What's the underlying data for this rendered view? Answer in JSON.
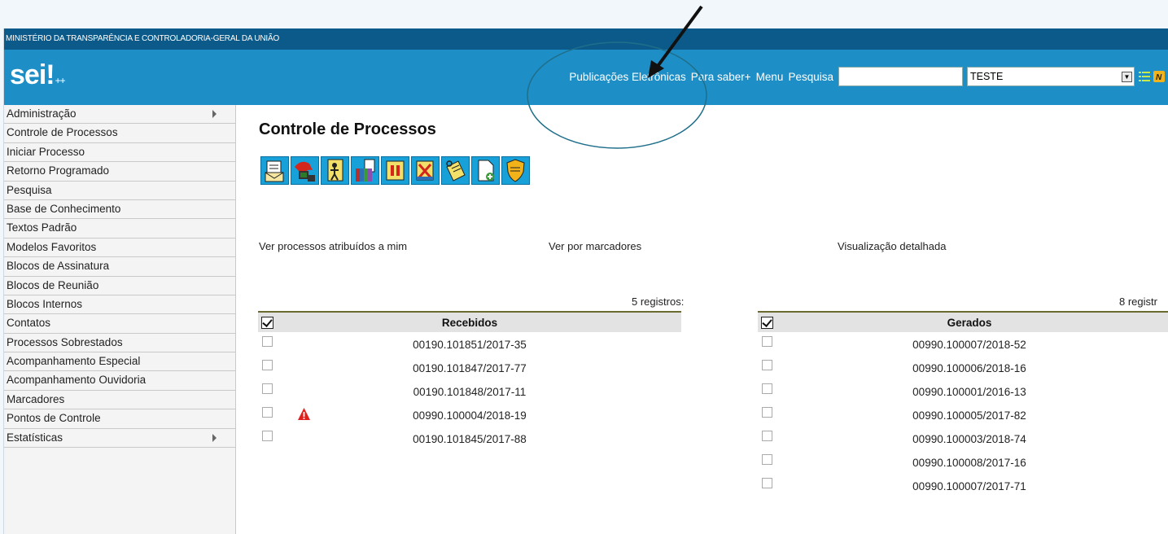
{
  "org_name": "MINISTÉRIO DA TRANSPARÊNCIA E CONTROLADORIA-GERAL DA UNIÃO",
  "logo": {
    "text": "sei!",
    "suffix": "++"
  },
  "nav": {
    "items": [
      "Publicações Eletrônicas",
      "Para saber+",
      "Menu",
      "Pesquisa"
    ],
    "search_value": "",
    "unit_value": "TESTE"
  },
  "sidebar": {
    "items": [
      {
        "label": "Administração",
        "submenu": true
      },
      {
        "label": "Controle de Processos"
      },
      {
        "label": "Iniciar Processo"
      },
      {
        "label": "Retorno Programado"
      },
      {
        "label": "Pesquisa"
      },
      {
        "label": "Base de Conhecimento"
      },
      {
        "label": "Textos Padrão"
      },
      {
        "label": "Modelos Favoritos"
      },
      {
        "label": "Blocos de Assinatura"
      },
      {
        "label": "Blocos de Reunião"
      },
      {
        "label": "Blocos Internos"
      },
      {
        "label": "Contatos"
      },
      {
        "label": "Processos Sobrestados"
      },
      {
        "label": "Acompanhamento Especial"
      },
      {
        "label": "Acompanhamento Ouvidoria"
      },
      {
        "label": "Marcadores"
      },
      {
        "label": "Pontos de Controle"
      },
      {
        "label": "Estatísticas",
        "submenu": true
      }
    ]
  },
  "main": {
    "title": "Controle de Processos",
    "toolbar_icons": [
      "send-process-icon",
      "remote-publish-icon",
      "assign-user-icon",
      "relate-docs-icon",
      "suspend-icon",
      "conclude-process-icon",
      "annotation-icon",
      "new-document-icon",
      "sigilo-shield-icon"
    ],
    "links": [
      "Ver processos atribuídos a mim",
      "Ver por marcadores",
      "Visualização detalhada"
    ],
    "received": {
      "count_label": "5 registros:",
      "title": "Recebidos",
      "rows": [
        {
          "number": "00190.101851/2017-35",
          "warning": false
        },
        {
          "number": "00190.101847/2017-77",
          "warning": false
        },
        {
          "number": "00190.101848/2017-11",
          "warning": false
        },
        {
          "number": "00990.100004/2018-19",
          "warning": true
        },
        {
          "number": "00190.101845/2017-88",
          "warning": false
        }
      ]
    },
    "generated": {
      "count_label": "8 registr",
      "title": "Gerados",
      "rows": [
        {
          "number": "00990.100007/2018-52"
        },
        {
          "number": "00990.100006/2018-16"
        },
        {
          "number": "00990.100001/2016-13"
        },
        {
          "number": "00990.100005/2017-82"
        },
        {
          "number": "00990.100003/2018-74"
        },
        {
          "number": "00990.100008/2017-16"
        },
        {
          "number": "00990.100007/2017-71"
        }
      ]
    }
  },
  "colors": {
    "topbar": "#0c5a89",
    "header": "#1d8ec6",
    "annotation": "#1f6f8a"
  }
}
